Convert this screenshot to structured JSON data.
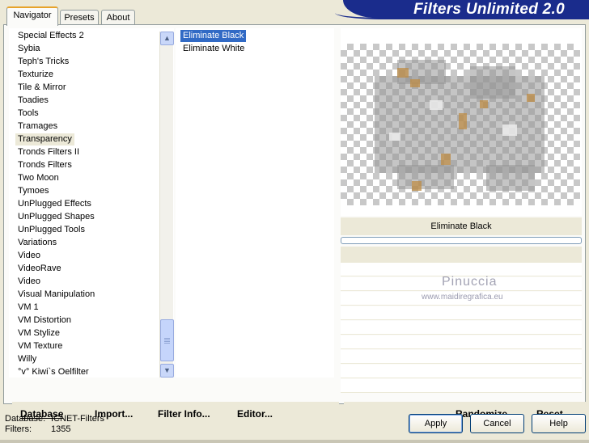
{
  "banner": {
    "title": "Filters Unlimited 2.0"
  },
  "tabs": [
    {
      "label": "Navigator",
      "active": true
    },
    {
      "label": "Presets",
      "active": false
    },
    {
      "label": "About",
      "active": false
    }
  ],
  "categories": [
    "Special Effects 2",
    "Sybia",
    "Teph's Tricks",
    "Texturize",
    "Tile & Mirror",
    "Toadies",
    "Tools",
    "Tramages",
    "Transparency",
    "Tronds Filters II",
    "Tronds Filters",
    "Two Moon",
    "Tymoes",
    "UnPlugged Effects",
    "UnPlugged Shapes",
    "UnPlugged Tools",
    "Variations",
    "Video",
    "VideoRave",
    "Video",
    "Visual Manipulation",
    "VM 1",
    "VM Distortion",
    "VM Stylize",
    "VM Texture",
    "Willy",
    "°v° Kiwi`s Oelfilter"
  ],
  "selected_category": "Transparency",
  "filters": [
    "Eliminate Black",
    "Eliminate White"
  ],
  "selected_filter": "Eliminate Black",
  "preview": {
    "filter_name": "Eliminate Black",
    "progress_fraction": 0
  },
  "watermark": {
    "line1": "Pinuccia",
    "line2": "www.maidiregrafica.eu"
  },
  "toolbar": {
    "database": "Database",
    "import": "Import...",
    "filter_info": "Filter Info...",
    "editor": "Editor...",
    "randomize": "Randomize",
    "reset": "Reset"
  },
  "status": {
    "database_label": "Database:",
    "database_value": "ICNET-Filters",
    "filters_label": "Filters:",
    "filters_value": "1355"
  },
  "buttons": {
    "apply": "Apply",
    "cancel": "Cancel",
    "help": "Help"
  },
  "icons": {
    "scroll_up": "chevron-up-icon",
    "scroll_down": "chevron-down-icon"
  }
}
